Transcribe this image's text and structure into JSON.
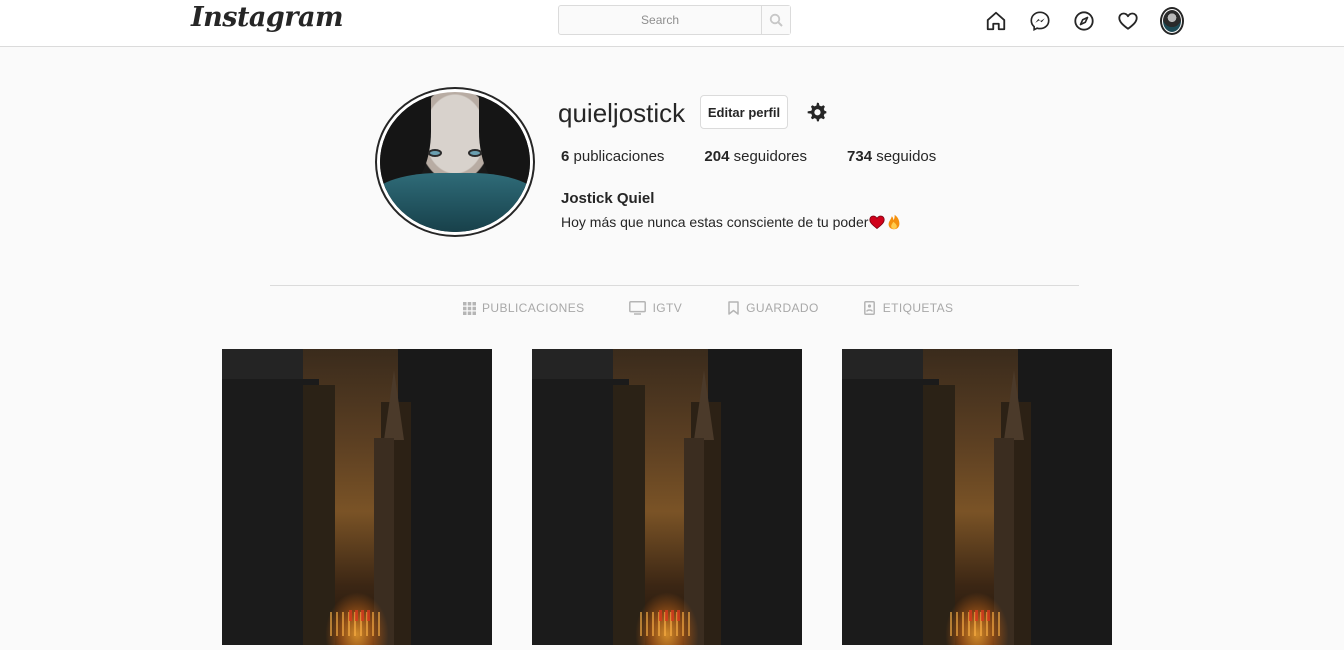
{
  "topbar": {
    "logo": "Instagram",
    "search_placeholder": "Search",
    "icons": [
      "home-icon",
      "messenger-icon",
      "explore-compass-icon",
      "heart-icon",
      "profile-avatar"
    ]
  },
  "profile": {
    "username": "quieljostick",
    "edit_label": "Editar perfil",
    "stats": {
      "posts_count": "6",
      "posts_label": "publicaciones",
      "followers_count": "204",
      "followers_label": "seguidores",
      "following_count": "734",
      "following_label": "seguidos"
    },
    "full_name": "Jostick Quiel",
    "bio": "Hoy más que nunca estas consciente de tu poder"
  },
  "tabs": [
    {
      "label": "PUBLICACIONES",
      "icon": "grid-icon"
    },
    {
      "label": "IGTV",
      "icon": "tv-icon"
    },
    {
      "label": "GUARDADO",
      "icon": "bookmark-icon"
    },
    {
      "label": "ETIQUETAS",
      "icon": "tag-icon"
    }
  ],
  "colors": {
    "background": "#fafafa",
    "border": "#dbdbdb",
    "text": "#262626",
    "muted": "#a8a8a8"
  }
}
